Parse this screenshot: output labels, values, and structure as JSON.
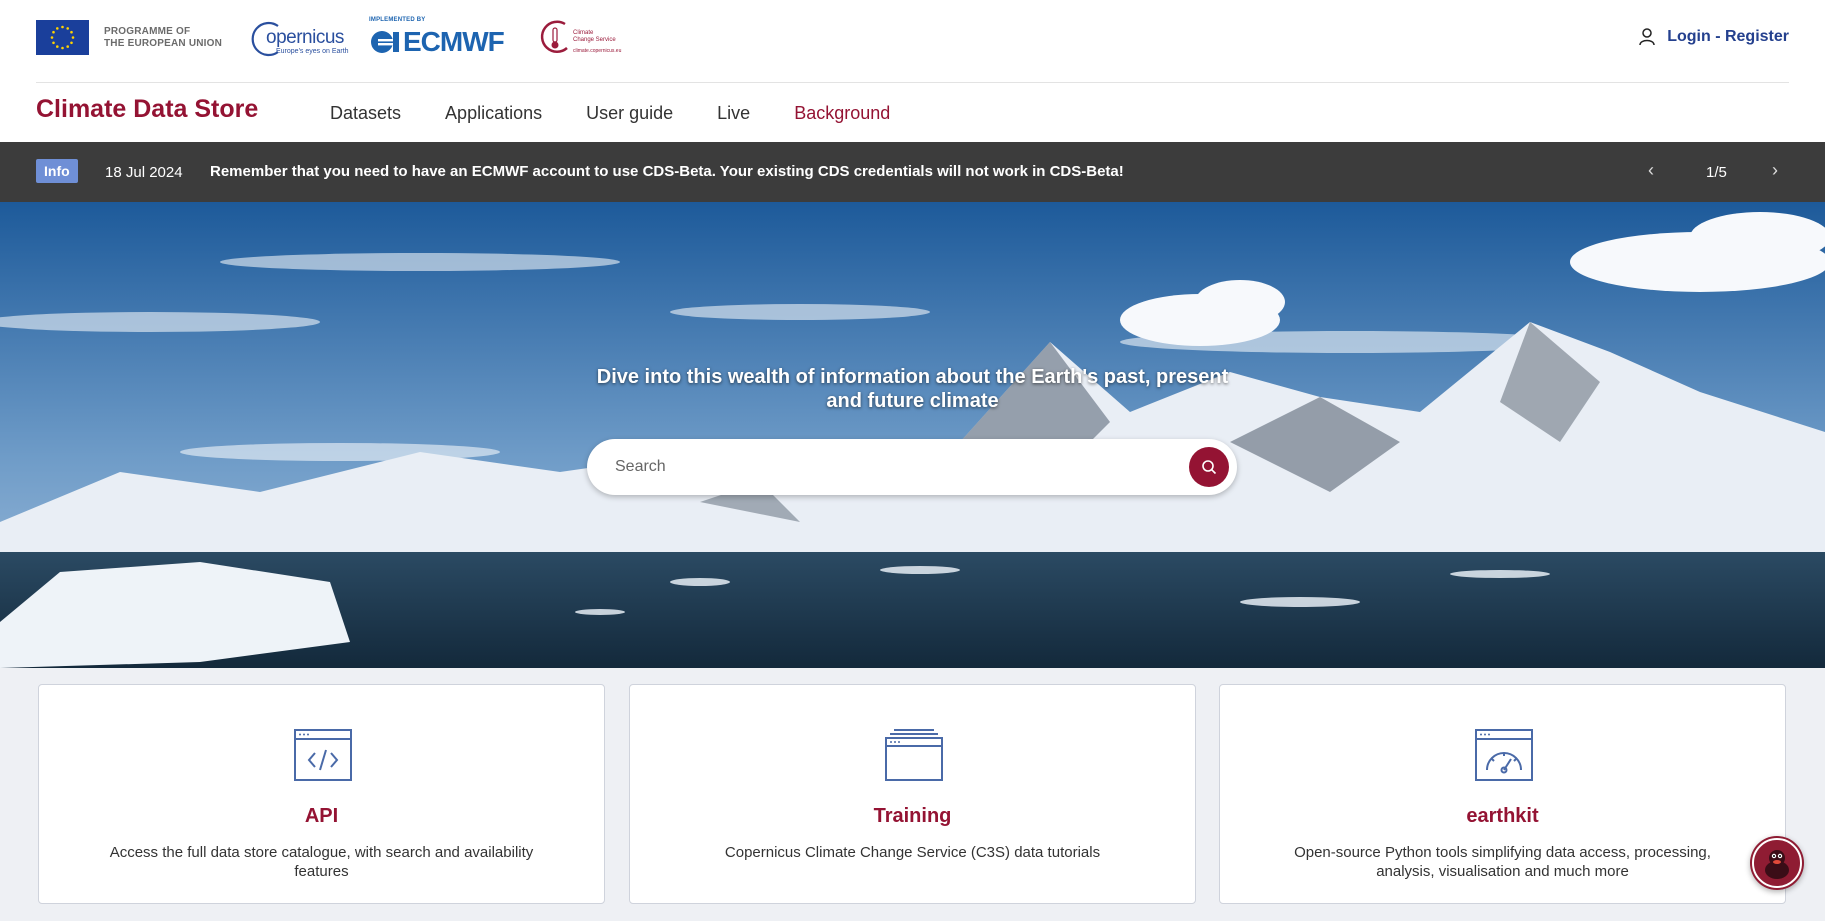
{
  "header": {
    "eu_programme_line1": "PROGRAMME OF",
    "eu_programme_line2": "THE EUROPEAN UNION",
    "copernicus_word": "opernicus",
    "copernicus_tagline": "Europe's eyes on Earth",
    "ecmwf_implemented_by": "IMPLEMENTED BY",
    "ecmwf_word": "ECMWF",
    "c3s_line1": "Climate",
    "c3s_line2": "Change Service",
    "c3s_url": "climate.copernicus.eu",
    "login_label": "Login - Register"
  },
  "nav": {
    "brand": "Climate Data Store",
    "items": [
      {
        "label": "Datasets"
      },
      {
        "label": "Applications"
      },
      {
        "label": "User guide"
      },
      {
        "label": "Live"
      },
      {
        "label": "Background"
      }
    ],
    "active_index": 4
  },
  "banner": {
    "badge": "Info",
    "date": "18 Jul 2024",
    "message": "Remember that you need to have an ECMWF account to use CDS-Beta. Your existing CDS credentials will not work in CDS-Beta!",
    "counter": "1/5",
    "prev_icon": "chevron-left-icon",
    "next_icon": "chevron-right-icon"
  },
  "hero": {
    "title": "Dive into this wealth of information about the Earth's past, present and future climate",
    "search_placeholder": "Search"
  },
  "cards": [
    {
      "title": "API",
      "description": "Access the full data store catalogue, with search and availability features",
      "icon": "code-window-icon"
    },
    {
      "title": "Training",
      "description": "Copernicus Climate Change Service (C3S) data tutorials",
      "icon": "stacked-windows-icon"
    },
    {
      "title": "earthkit",
      "description": "Open-source Python tools simplifying data access, processing, analysis, visualisation and much more",
      "icon": "gauge-window-icon"
    }
  ],
  "colors": {
    "brand": "#941333",
    "link": "#24408e",
    "banner_bg": "#3c3c3c",
    "info_badge": "#6f8fd6"
  }
}
